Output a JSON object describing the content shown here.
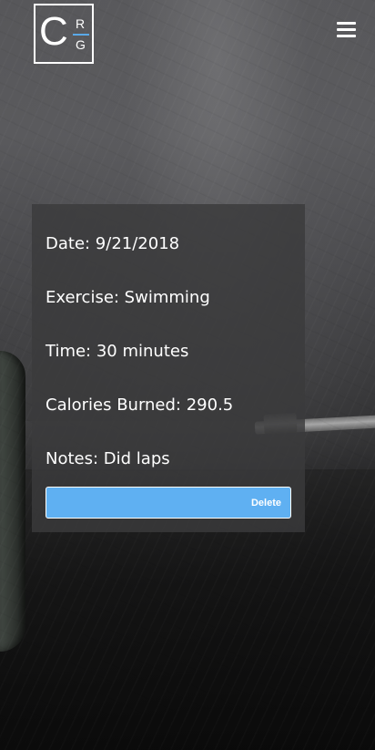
{
  "brand": {
    "logo_c": "C",
    "logo_r": "R",
    "logo_g": "G",
    "accent_color": "#5aa9e8"
  },
  "header": {
    "menu_icon": "hamburger-menu-icon"
  },
  "entry": {
    "date": "Date: 9/21/2018",
    "exercise": "Exercise: Swimming",
    "time": "Time: 30 minutes",
    "calories": "Calories Burned: 290.5",
    "notes": "Notes: Did laps"
  },
  "actions": {
    "delete_label": "Delete",
    "delete_color": "#5fb0f2"
  }
}
